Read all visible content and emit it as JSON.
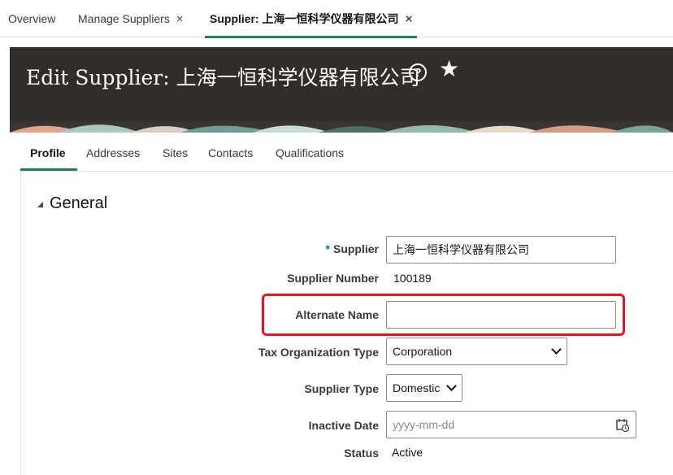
{
  "top_tabs": [
    {
      "label": "Overview",
      "closable": false
    },
    {
      "label": "Manage Suppliers",
      "closable": true
    },
    {
      "label": "Supplier: 上海一恒科学仪器有限公司",
      "closable": true,
      "active": true
    }
  ],
  "close_glyph": "×",
  "header": {
    "title": "Edit Supplier: 上海一恒科学仪器有限公司",
    "help_glyph": "?",
    "star_glyph": "★"
  },
  "profile_tabs": [
    "Profile",
    "Addresses",
    "Sites",
    "Contacts",
    "Qualifications"
  ],
  "section": {
    "title": "General"
  },
  "form": {
    "required_marker": "*",
    "supplier": {
      "label": "Supplier",
      "value": "上海一恒科学仪器有限公司"
    },
    "supplier_number": {
      "label": "Supplier Number",
      "value": "100189"
    },
    "alternate_name": {
      "label": "Alternate Name",
      "value": ""
    },
    "tax_org_type": {
      "label": "Tax Organization Type",
      "value": "Corporation"
    },
    "supplier_type": {
      "label": "Supplier Type",
      "value": "Domestic"
    },
    "inactive_date": {
      "label": "Inactive Date",
      "value": "",
      "placeholder": "yyyy-mm-dd"
    },
    "status": {
      "label": "Status",
      "value": "Active"
    }
  },
  "colors": {
    "accent_green": "#227e5a",
    "header_bg": "#312d2a",
    "highlight_red": "#e8141d",
    "required_blue": "#0572ce"
  }
}
